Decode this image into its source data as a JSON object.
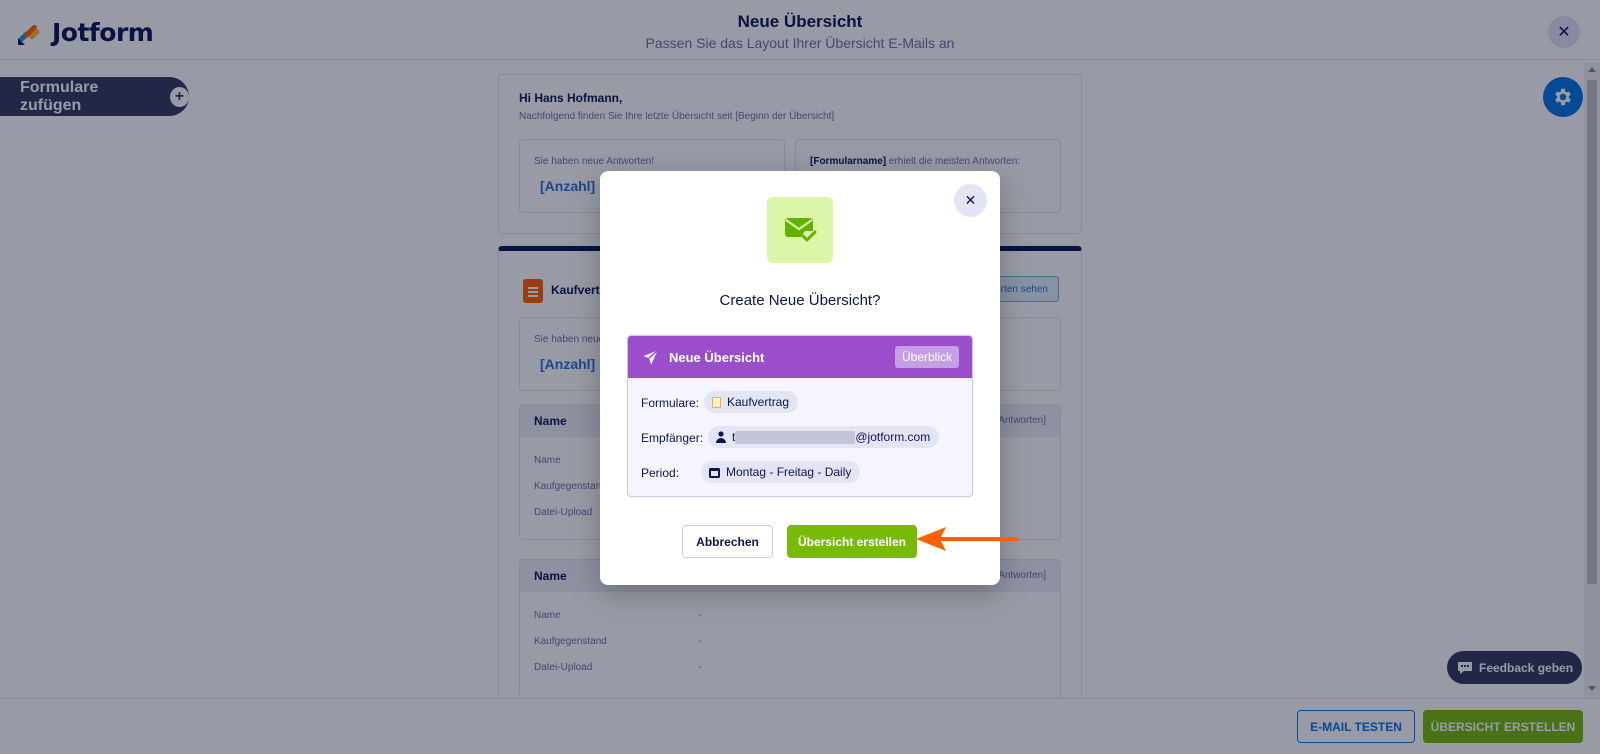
{
  "header": {
    "logo_text": "Jotform",
    "title": "Neue Übersicht",
    "subtitle": "Passen Sie das Layout Ihrer Übersicht E-Mails an",
    "close_icon": "close-icon"
  },
  "sidebar": {
    "add_forms_label": "Formulare zufügen"
  },
  "preview": {
    "greeting": "Hi Hans Hofmann,",
    "intro": "Nachfolgend finden Sie Ihre letzte Übersicht seit [Beginn der Übersicht]",
    "stats_label": "Sie haben neue Antworten!",
    "stats_count": "[Anzahl]",
    "top_form_name": "[Formularname]",
    "top_form_suffix": "erhielt die meisten Antworten:",
    "form_title_partial": "Kaufvertr",
    "see_answers_partial": "orten sehen",
    "form_stats_label_partial": "Sie haben neue",
    "form_stats_count": "[Anzahl]",
    "section_title": "Name",
    "section_suffix": "Antworten]",
    "fields": [
      "Name",
      "Kaufgegenstand",
      "Datei-Upload"
    ],
    "empty_value": "-"
  },
  "modal": {
    "title": "Create Neue Übersicht?",
    "summary_name": "Neue Übersicht",
    "summary_badge": "Überblick",
    "forms_label": "Formulare:",
    "forms_value": "Kaufvertrag",
    "recipient_label": "Empfänger:",
    "recipient_prefix": "t",
    "recipient_domain": "@jotform.com",
    "period_label": "Period:",
    "period_value": "Montag - Freitag - Daily",
    "cancel_label": "Abbrechen",
    "confirm_label": "Übersicht erstellen"
  },
  "bottom_bar": {
    "test_label": "E-MAIL TESTEN",
    "create_label": "ÜBERSICHT ERSTELLEN"
  },
  "feedback_label": "Feedback geben",
  "colors": {
    "navy": "#0a1551",
    "primary_blue": "#0075e3",
    "green": "#78bb07",
    "purple": "#9b4ecc",
    "annotation_arrow": "#ff6100"
  }
}
